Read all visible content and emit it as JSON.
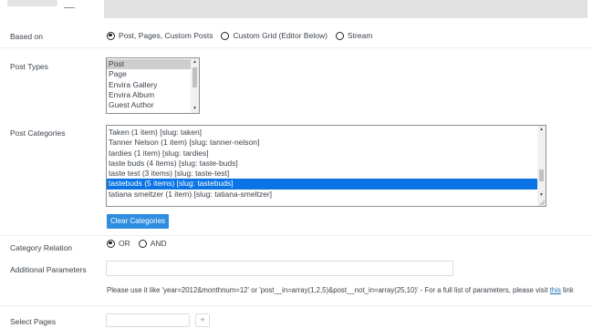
{
  "based_on": {
    "label": "Based on",
    "options": [
      {
        "label": "Post, Pages, Custom Posts",
        "checked": true
      },
      {
        "label": "Custom Grid (Editor Below)",
        "checked": false
      },
      {
        "label": "Stream",
        "checked": false
      }
    ]
  },
  "post_types": {
    "label": "Post Types",
    "items": [
      "Post",
      "Page",
      "Envira Gallery",
      "Envira Album",
      "Guest Author"
    ],
    "selected_index": 0
  },
  "post_categories": {
    "label": "Post Categories",
    "items": [
      "Taken (1 item) [slug: taken]",
      "Tanner Nelson (1 item) [slug: tanner-nelson]",
      "tardies (1 item) [slug: tardies]",
      "taste buds (4 items) [slug: taste-buds]",
      "taste test (3 items) [slug: taste-test]",
      "tastebuds (5 items) [slug: tastebuds]",
      "tatiana smeltzer (1 item) [slug: tatiana-smeltzer]"
    ],
    "selected_index": 5,
    "clear_button": "Clear Categories"
  },
  "category_relation": {
    "label": "Category Relation",
    "options": [
      {
        "label": "OR",
        "checked": true
      },
      {
        "label": "AND",
        "checked": false
      }
    ]
  },
  "additional_parameters": {
    "label": "Additional Parameters",
    "value": "",
    "help_text": "Please use it like 'year=2012&monthnum=12' or 'post__in=array(1,2,5)&post__not_in=array(25,10)'  -  For a full list of parameters, please visit ",
    "help_link": "this",
    "help_suffix": " link"
  },
  "select_pages": {
    "label": "Select Pages",
    "value": "",
    "add_label": "+"
  },
  "icons": {
    "scroll_up": "triangle-up",
    "scroll_down": "triangle-down"
  },
  "colors": {
    "selected_blue": "#0b74e5",
    "button_blue": "#2f8de0",
    "link": "#2271b1"
  }
}
